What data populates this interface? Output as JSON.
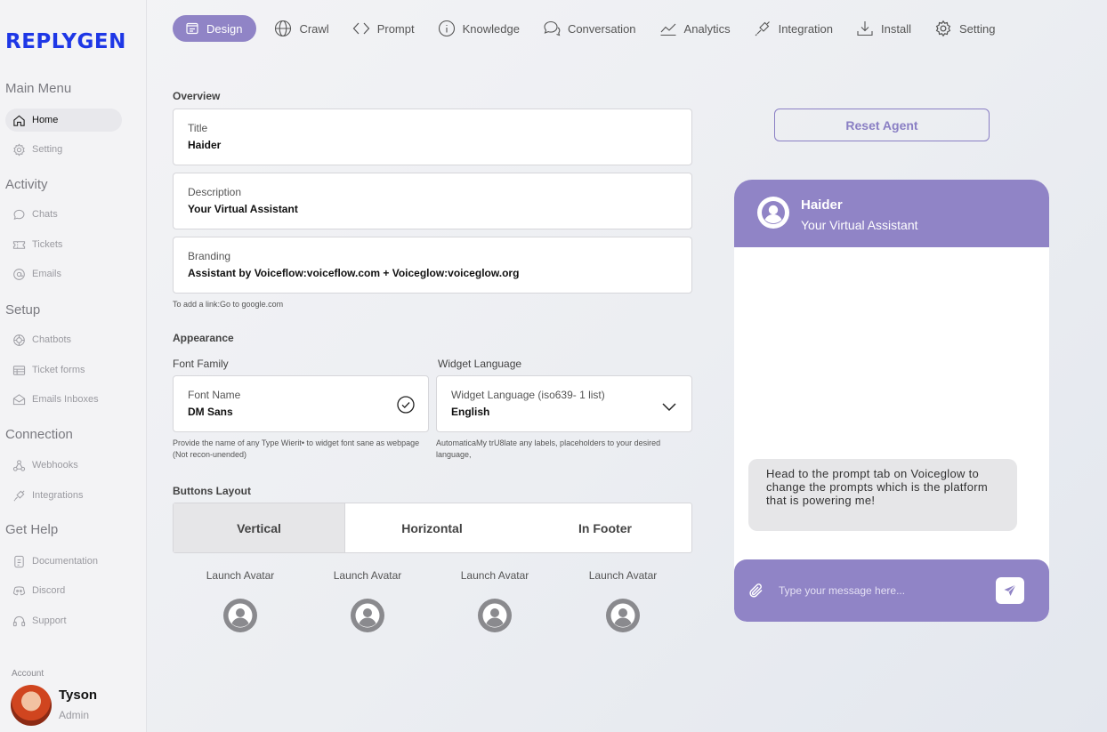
{
  "brand": {
    "logo": "REPLYGEN",
    "color": "#1e37e6",
    "accent": "#9084c6"
  },
  "sidebar": {
    "sections": {
      "main": "Main Menu",
      "activity": "Activity",
      "setup": "Setup",
      "connection": "Connection",
      "help": "Get Help"
    },
    "items": [
      {
        "label": "Home",
        "icon": "home-icon"
      },
      {
        "label": "Setting",
        "icon": "gear-icon"
      },
      {
        "label": "Chats",
        "icon": "chat-bubble-icon"
      },
      {
        "label": "Tickets",
        "icon": "ticket-icon"
      },
      {
        "label": "Emails",
        "icon": "at-sign-icon"
      },
      {
        "label": "Chatbots",
        "icon": "chatbot-icon"
      },
      {
        "label": "Ticket forms",
        "icon": "form-icon"
      },
      {
        "label": "Emails Inboxes",
        "icon": "inbox-icon"
      },
      {
        "label": "Webhooks",
        "icon": "webhook-icon"
      },
      {
        "label": "Integrations",
        "icon": "plug-icon"
      },
      {
        "label": "Documentation",
        "icon": "document-icon"
      },
      {
        "label": "Discord",
        "icon": "discord-icon"
      },
      {
        "label": "Support",
        "icon": "headset-icon"
      }
    ],
    "account": {
      "label": "Account",
      "name": "Tyson",
      "role": "Admin"
    }
  },
  "topnav": {
    "tabs": [
      {
        "label": "Design",
        "icon": "design-icon"
      },
      {
        "label": "Crawl",
        "icon": "globe-icon"
      },
      {
        "label": "Prompt",
        "icon": "code-icon"
      },
      {
        "label": "Knowledge",
        "icon": "info-icon"
      },
      {
        "label": "Conversation",
        "icon": "conversation-icon"
      },
      {
        "label": "Analytics",
        "icon": "line-chart-icon"
      },
      {
        "label": "Integration",
        "icon": "plug-icon"
      },
      {
        "label": "Install",
        "icon": "download-icon"
      },
      {
        "label": "Setting",
        "icon": "gear-icon"
      }
    ]
  },
  "overview": {
    "heading": "Overview",
    "title": {
      "label": "Title",
      "value": "Haider"
    },
    "description": {
      "label": "Description",
      "value": "Your Virtual Assistant"
    },
    "branding": {
      "label": "Branding",
      "value": "Assistant by Voiceflow:voiceflow.com + Voiceglow:voiceglow.org"
    },
    "link_hint": "To add a link:Go to google.com"
  },
  "appearance": {
    "heading": "Appearance",
    "font_family_label": "Font Family",
    "font": {
      "label": "Font Name",
      "value": "DM Sans"
    },
    "font_hint": "Provide the name of any Type Wierit• to widget font sane as webpage (Not recon-unended)",
    "widget_language_label": "Widget Language",
    "language": {
      "label": "Widget Language (iso639- 1 list)",
      "value": "English"
    },
    "language_hint": "AutomaticaMy trU8late any labels, placeholders to your desired language,"
  },
  "buttons_layout": {
    "heading": "Buttons Layout",
    "options": [
      "Vertical",
      "Horizontal",
      "In Footer"
    ],
    "selected": "Vertical",
    "launch_avatar_label": "Launch Avatar"
  },
  "preview": {
    "reset_label": "Reset Agent",
    "name": "Haider",
    "subtitle": "Your Virtual Assistant",
    "message": "Head to the prompt tab on Voiceglow to change the prompts which is the platform that is powering me!",
    "input_placeholder": "Type your message here..."
  }
}
